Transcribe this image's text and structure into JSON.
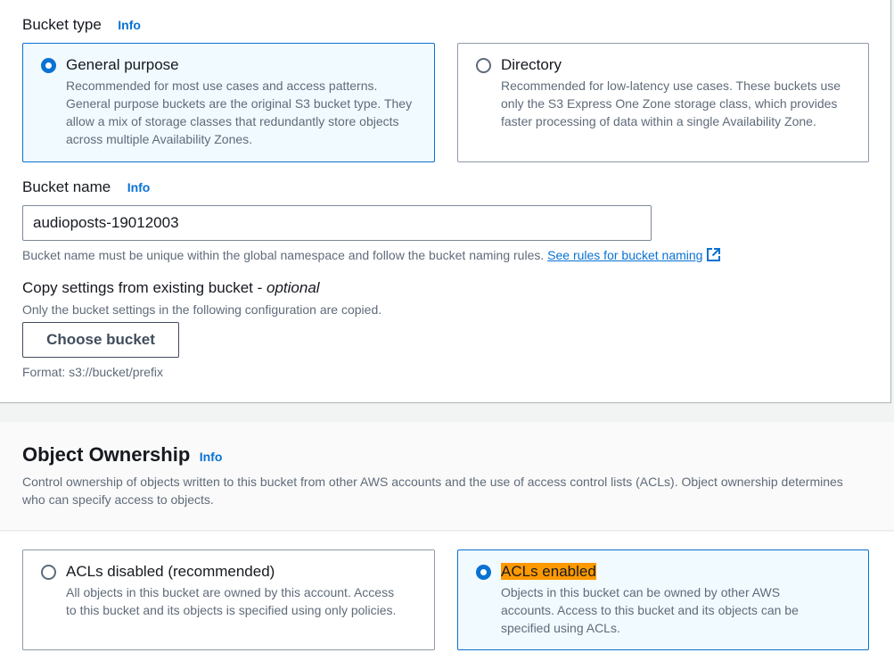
{
  "bucket_type": {
    "label": "Bucket type",
    "info": "Info",
    "options": [
      {
        "title": "General purpose",
        "description": "Recommended for most use cases and access patterns. General purpose buckets are the original S3 bucket type. They allow a mix of storage classes that redundantly store objects across multiple Availability Zones.",
        "selected": true
      },
      {
        "title": "Directory",
        "description": "Recommended for low-latency use cases. These buckets use only the S3 Express One Zone storage class, which provides faster processing of data within a single Availability Zone.",
        "selected": false
      }
    ]
  },
  "bucket_name": {
    "label": "Bucket name",
    "info": "Info",
    "value": "audioposts-19012003",
    "hint": "Bucket name must be unique within the global namespace and follow the bucket naming rules.",
    "link": "See rules for bucket naming"
  },
  "copy_settings": {
    "label": "Copy settings from existing bucket - ",
    "optional": "optional",
    "description": "Only the bucket settings in the following configuration are copied.",
    "button": "Choose bucket",
    "format_hint": "Format: s3://bucket/prefix"
  },
  "object_ownership": {
    "title": "Object Ownership",
    "info": "Info",
    "description": "Control ownership of objects written to this bucket from other AWS accounts and the use of access control lists (ACLs). Object ownership determines who can specify access to objects.",
    "options": [
      {
        "title": "ACLs disabled (recommended)",
        "description": "All objects in this bucket are owned by this account. Access to this bucket and its objects is specified using only policies.",
        "selected": false
      },
      {
        "title": "ACLs enabled",
        "description": "Objects in this bucket can be owned by other AWS accounts. Access to this bucket and its objects can be specified using ACLs.",
        "selected": true
      }
    ]
  },
  "colors": {
    "accent": "#0972d3",
    "highlight": "#ff9900",
    "selected_tile_bg": "#f1faff"
  }
}
